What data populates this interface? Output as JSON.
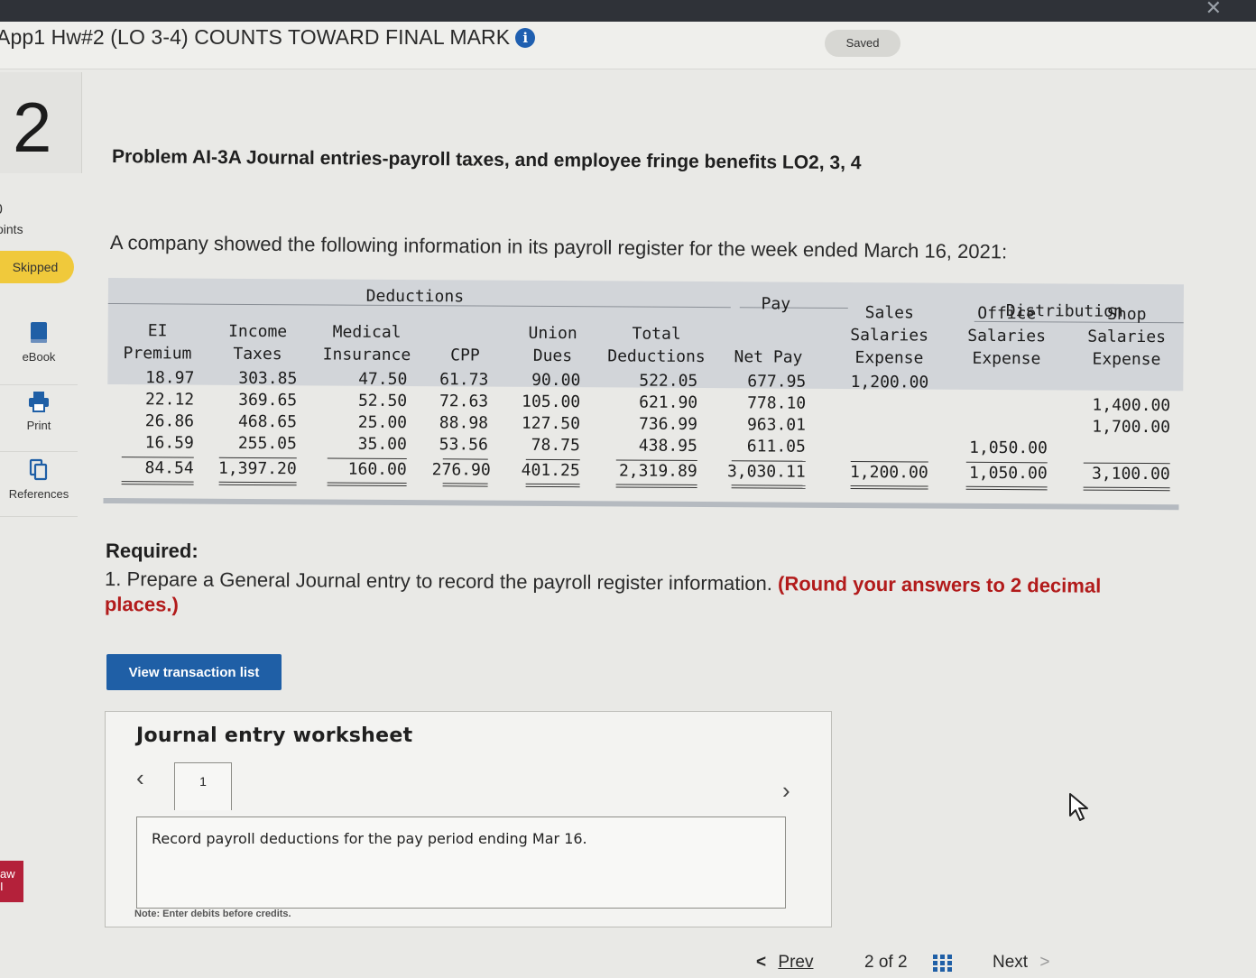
{
  "header": {
    "title": "App1 Hw#2 (LO 3-4) COUNTS TOWARD FINAL MARK",
    "info_icon": "info-icon",
    "saved_label": "Saved"
  },
  "sidebar": {
    "question_number": "2",
    "points_value": "0",
    "points_label": "oints",
    "status_badge": "Skipped",
    "tools": [
      {
        "label": "eBook",
        "icon": "book-icon"
      },
      {
        "label": "Print",
        "icon": "printer-icon"
      },
      {
        "label": "References",
        "icon": "copy-icon"
      }
    ],
    "bottom_badge_line1": "aw",
    "bottom_badge_line2": "I"
  },
  "problem": {
    "title": "Problem AI-3A Journal entries-payroll taxes, and employee fringe benefits LO2, 3, 4",
    "intro": "A company showed the following information in its payroll register for the week ended March 16, 2021:"
  },
  "register": {
    "group_deductions": "Deductions",
    "group_pay": "Pay",
    "group_distribution": "Distribution",
    "columns": [
      [
        "EI",
        "Premium"
      ],
      [
        "Income",
        "Taxes"
      ],
      [
        "Medical",
        "Insurance"
      ],
      [
        "CPP"
      ],
      [
        "Union",
        "Dues"
      ],
      [
        "Total",
        "Deductions"
      ],
      [
        "Net Pay"
      ],
      [
        "Sales",
        "Salaries",
        "Expense"
      ],
      [
        "Office",
        "Salaries",
        "Expense"
      ],
      [
        "Shop",
        "Salaries",
        "Expense"
      ]
    ],
    "rows": [
      [
        "18.97",
        "303.85",
        "47.50",
        "61.73",
        "90.00",
        "522.05",
        "677.95",
        "1,200.00",
        "",
        ""
      ],
      [
        "22.12",
        "369.65",
        "52.50",
        "72.63",
        "105.00",
        "621.90",
        "778.10",
        "",
        "",
        "1,400.00"
      ],
      [
        "26.86",
        "468.65",
        "25.00",
        "88.98",
        "127.50",
        "736.99",
        "963.01",
        "",
        "",
        "1,700.00"
      ],
      [
        "16.59",
        "255.05",
        "35.00",
        "53.56",
        "78.75",
        "438.95",
        "611.05",
        "",
        "1,050.00",
        ""
      ]
    ],
    "totals": [
      "84.54",
      "1,397.20",
      "160.00",
      "276.90",
      "401.25",
      "2,319.89",
      "3,030.11",
      "1,200.00",
      "1,050.00",
      "3,100.00"
    ]
  },
  "required": {
    "label": "Required:",
    "item1_number": "1.",
    "item1_text": "Prepare a General Journal entry to record the payroll register information.",
    "item1_emphasis": "(Round your answers to 2 decimal places.)"
  },
  "view_transaction_button": "View transaction list",
  "worksheet": {
    "title": "Journal entry worksheet",
    "tab_label": "1",
    "description": "Record payroll deductions for the pay period ending Mar 16.",
    "note": "Note: Enter debits before credits."
  },
  "pager": {
    "prev_label": "Prev",
    "page_current": "2",
    "page_of": "of",
    "page_total": "2",
    "next_label": "Next"
  },
  "colors": {
    "accent_blue": "#1f5fa6",
    "skipped_yellow": "#f0c93b",
    "emphasis_red": "#b21b1b"
  }
}
